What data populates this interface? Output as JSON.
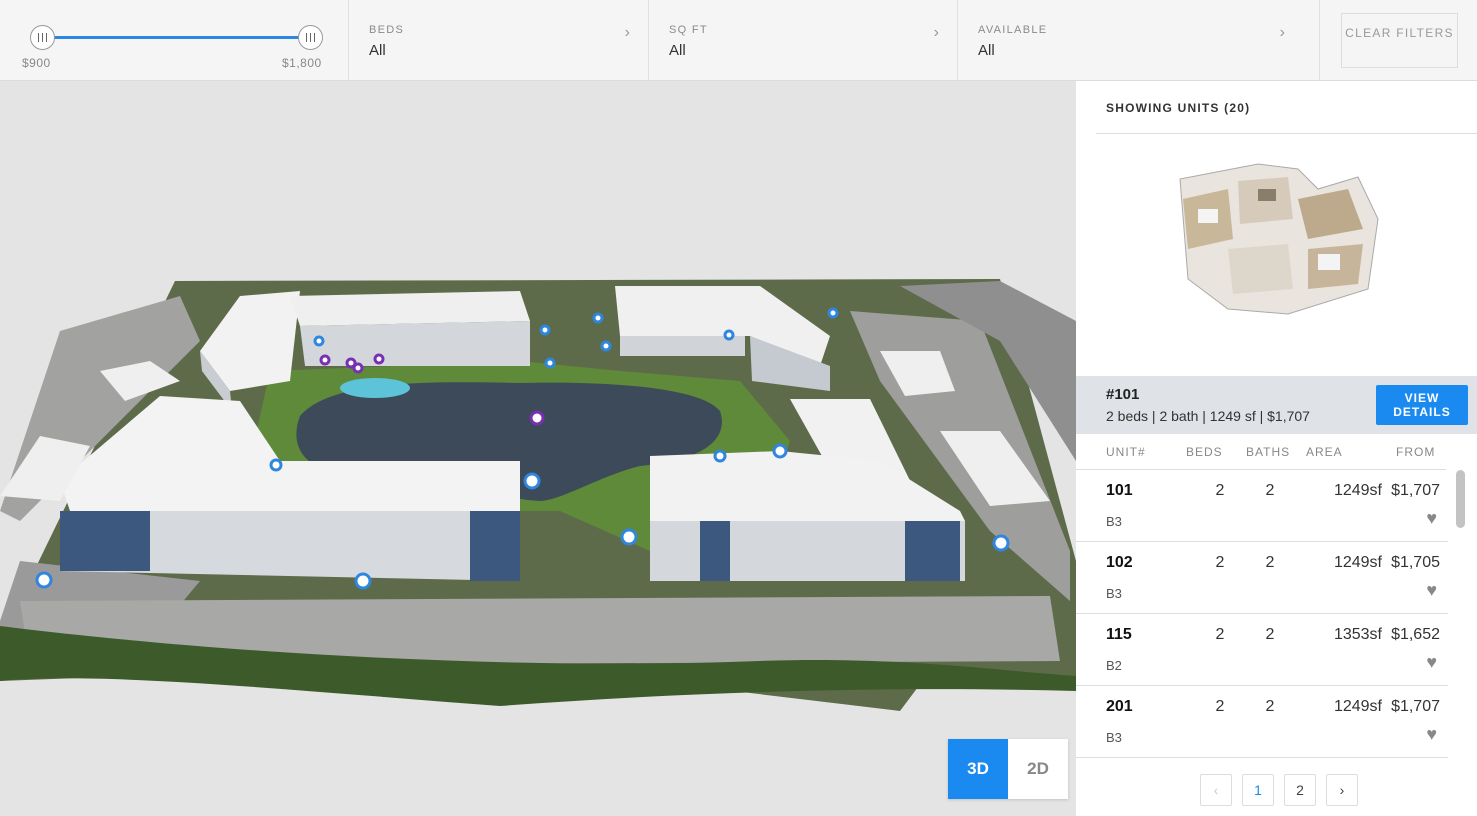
{
  "filters": {
    "price": {
      "min_label": "$900",
      "max_label": "$1,800",
      "min_value": 900,
      "max_value": 1800
    },
    "beds": {
      "label": "BEDS",
      "value": "All"
    },
    "sqft": {
      "label": "SQ FT",
      "value": "All"
    },
    "available": {
      "label": "AVAILABLE",
      "value": "All"
    },
    "clear_label": "CLEAR FILTERS"
  },
  "view_toggle": {
    "three_d": "3D",
    "two_d": "2D",
    "active": "3D"
  },
  "panel": {
    "showing_label": "SHOWING UNITS (20)",
    "selected": {
      "unit": "#101",
      "info": "2 beds | 2 bath | 1249 sf | $1,707",
      "button": "VIEW DETAILS"
    },
    "columns": {
      "unit": "UNIT#",
      "beds": "BEDS",
      "baths": "BATHS",
      "area": "AREA",
      "from": "FROM"
    },
    "units": [
      {
        "unit": "101",
        "beds": "2",
        "baths": "2",
        "area": "1249sf",
        "price": "$1,707",
        "plan": "B3"
      },
      {
        "unit": "102",
        "beds": "2",
        "baths": "2",
        "area": "1249sf",
        "price": "$1,705",
        "plan": "B3"
      },
      {
        "unit": "115",
        "beds": "2",
        "baths": "2",
        "area": "1353sf",
        "price": "$1,652",
        "plan": "B2"
      },
      {
        "unit": "201",
        "beds": "2",
        "baths": "2",
        "area": "1249sf",
        "price": "$1,707",
        "plan": "B3"
      }
    ],
    "pagination": {
      "prev": "‹",
      "pages": [
        "1",
        "2"
      ],
      "current": "1",
      "next": "›"
    }
  },
  "colors": {
    "accent": "#1a8af0",
    "slider": "#2f86df",
    "pin_blue": "#2f86df",
    "pin_purple": "#7a2fb3"
  },
  "icons": {
    "heart": "heart-icon",
    "chevron": "chevron-right-icon"
  }
}
